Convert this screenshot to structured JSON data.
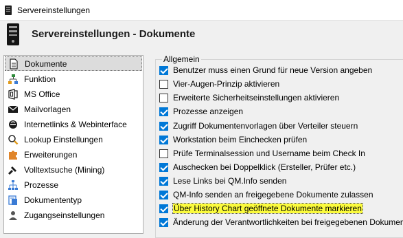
{
  "window": {
    "title": "Servereinstellungen"
  },
  "header": {
    "title": "Servereinstellungen - Dokumente"
  },
  "sidebar": {
    "items": [
      {
        "label": "Dokumente",
        "icon": "document-icon",
        "selected": true
      },
      {
        "label": "Funktion",
        "icon": "hierarchy-icon"
      },
      {
        "label": "MS Office",
        "icon": "office-icon"
      },
      {
        "label": "Mailvorlagen",
        "icon": "mail-icon"
      },
      {
        "label": "Internetlinks & Webinterface",
        "icon": "internet-icon"
      },
      {
        "label": "Lookup Einstellungen",
        "icon": "lookup-icon"
      },
      {
        "label": "Erweiterungen",
        "icon": "puzzle-icon"
      },
      {
        "label": "Volltextsuche (Mining)",
        "icon": "search-icon"
      },
      {
        "label": "Prozesse",
        "icon": "process-icon"
      },
      {
        "label": "Dokumententyp",
        "icon": "doctype-icon"
      },
      {
        "label": "Zugangseinstellungen",
        "icon": "access-icon"
      }
    ]
  },
  "general": {
    "legend": "Allgemein",
    "options": [
      {
        "label": "Benutzer muss einen Grund für neue Version angeben",
        "checked": true
      },
      {
        "label": "Vier-Augen-Prinzip aktivieren",
        "checked": false
      },
      {
        "label": "Erweiterte Sicherheitseinstellungen aktivieren",
        "checked": false
      },
      {
        "label": "Prozesse anzeigen",
        "checked": true
      },
      {
        "label": "Zugriff Dokumentenvorlagen über Verteiler steuern",
        "checked": true
      },
      {
        "label": "Workstation beim Einchecken prüfen",
        "checked": true
      },
      {
        "label": "Prüfe Terminalsession und Username beim Check In",
        "checked": false
      },
      {
        "label": "Auschecken bei Doppelklick (Ersteller, Prüfer etc.)",
        "checked": true
      },
      {
        "label": "Lese Links bei QM.Info senden",
        "checked": true
      },
      {
        "label": "QM-Info senden an freigegebene Dokumente zulassen",
        "checked": true
      },
      {
        "label": "Über History Chart geöffnete Dokumente markieren",
        "checked": true,
        "highlighted": true
      },
      {
        "label": "Änderung der Verantwortlichkeiten bei freigegebenen Dokumenten",
        "checked": true
      }
    ]
  },
  "colors": {
    "accent": "#0078d7",
    "highlight": "#fbfb3c",
    "selection": "#dcdcdc"
  }
}
